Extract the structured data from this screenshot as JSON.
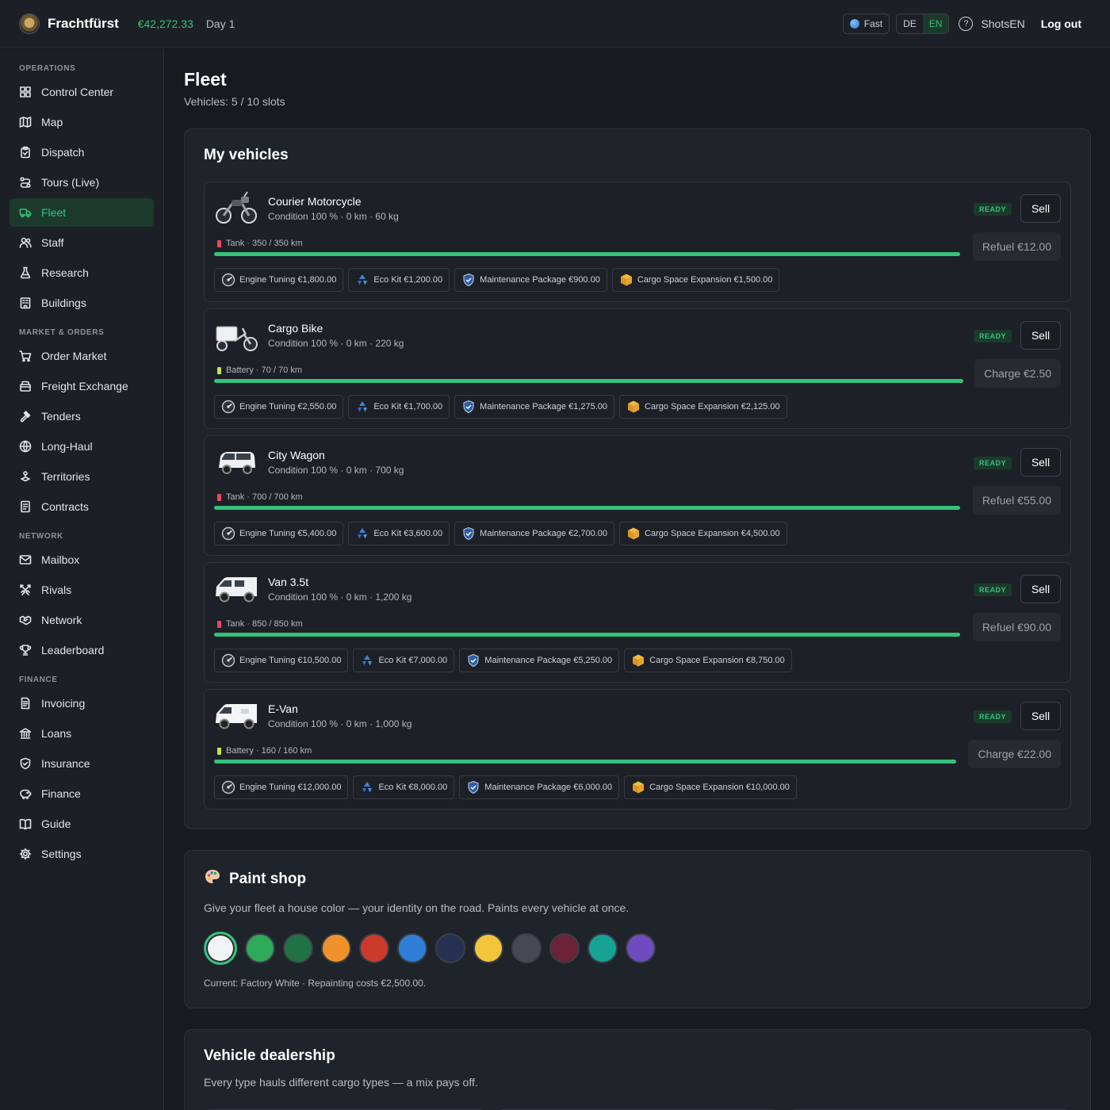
{
  "header": {
    "brand": "Frachtfürst",
    "balance": "€42,272.33",
    "day": "Day 1",
    "speed": "Fast",
    "languages": [
      "DE",
      "EN"
    ],
    "active_language": "EN",
    "user": "ShotsEN",
    "logout": "Log out"
  },
  "sidebar": {
    "sections": [
      {
        "title": "OPERATIONS",
        "items": [
          {
            "label": "Control Center",
            "icon": "grid-icon"
          },
          {
            "label": "Map",
            "icon": "map-icon"
          },
          {
            "label": "Dispatch",
            "icon": "clipboard-icon"
          },
          {
            "label": "Tours (Live)",
            "icon": "route-icon"
          },
          {
            "label": "Fleet",
            "icon": "truck-icon",
            "active": true
          },
          {
            "label": "Staff",
            "icon": "users-icon"
          },
          {
            "label": "Research",
            "icon": "flask-icon"
          },
          {
            "label": "Buildings",
            "icon": "building-icon"
          }
        ]
      },
      {
        "title": "MARKET & ORDERS",
        "items": [
          {
            "label": "Order Market",
            "icon": "cart-icon"
          },
          {
            "label": "Freight Exchange",
            "icon": "exchange-icon"
          },
          {
            "label": "Tenders",
            "icon": "gavel-icon"
          },
          {
            "label": "Long-Haul",
            "icon": "globe-icon"
          },
          {
            "label": "Territories",
            "icon": "territory-icon"
          },
          {
            "label": "Contracts",
            "icon": "contract-icon"
          }
        ]
      },
      {
        "title": "NETWORK",
        "items": [
          {
            "label": "Mailbox",
            "icon": "mail-icon"
          },
          {
            "label": "Rivals",
            "icon": "swords-icon"
          },
          {
            "label": "Network",
            "icon": "handshake-icon"
          },
          {
            "label": "Leaderboard",
            "icon": "trophy-icon"
          }
        ]
      },
      {
        "title": "FINANCE",
        "items": [
          {
            "label": "Invoicing",
            "icon": "invoice-icon"
          },
          {
            "label": "Loans",
            "icon": "bank-icon"
          },
          {
            "label": "Insurance",
            "icon": "shield-icon"
          },
          {
            "label": "Finance",
            "icon": "piggy-icon"
          },
          {
            "label": "Guide",
            "icon": "book-icon"
          },
          {
            "label": "Settings",
            "icon": "gear-icon"
          }
        ]
      }
    ]
  },
  "page": {
    "title": "Fleet",
    "subtitle": "Vehicles: 5 / 10 slots"
  },
  "vehicles_card": {
    "title": "My vehicles",
    "vehicles": [
      {
        "name": "Courier Motorcycle",
        "meta": "Condition 100 % · 0 km · 60 kg",
        "status": "READY",
        "sell": "Sell",
        "energy_label": "Tank · 350 / 350 km",
        "energy_type": "tank",
        "energy_level": 1.0,
        "refuel": "Refuel €12.00",
        "icon": "motorcycle-icon",
        "upgrades": [
          {
            "label": "Engine Tuning €1,800.00",
            "icon": "engine-icon"
          },
          {
            "label": "Eco Kit €1,200.00",
            "icon": "eco-icon"
          },
          {
            "label": "Maintenance Package €900.00",
            "icon": "shield-icon"
          },
          {
            "label": "Cargo Space Expansion €1,500.00",
            "icon": "cargo-icon"
          }
        ]
      },
      {
        "name": "Cargo Bike",
        "meta": "Condition 100 % · 0 km · 220 kg",
        "status": "READY",
        "sell": "Sell",
        "energy_label": "Battery · 70 / 70 km",
        "energy_type": "battery",
        "energy_level": 1.0,
        "refuel": "Charge €2.50",
        "icon": "cargo-bike-icon",
        "upgrades": [
          {
            "label": "Engine Tuning €2,550.00",
            "icon": "engine-icon"
          },
          {
            "label": "Eco Kit €1,700.00",
            "icon": "eco-icon"
          },
          {
            "label": "Maintenance Package €1,275.00",
            "icon": "shield-icon"
          },
          {
            "label": "Cargo Space Expansion €2,125.00",
            "icon": "cargo-icon"
          }
        ]
      },
      {
        "name": "City Wagon",
        "meta": "Condition 100 % · 0 km · 700 kg",
        "status": "READY",
        "sell": "Sell",
        "energy_label": "Tank · 700 / 700 km",
        "energy_type": "tank",
        "energy_level": 1.0,
        "refuel": "Refuel €55.00",
        "icon": "city-wagon-icon",
        "upgrades": [
          {
            "label": "Engine Tuning €5,400.00",
            "icon": "engine-icon"
          },
          {
            "label": "Eco Kit €3,600.00",
            "icon": "eco-icon"
          },
          {
            "label": "Maintenance Package €2,700.00",
            "icon": "shield-icon"
          },
          {
            "label": "Cargo Space Expansion €4,500.00",
            "icon": "cargo-icon"
          }
        ]
      },
      {
        "name": "Van 3.5t",
        "meta": "Condition 100 % · 0 km · 1,200 kg",
        "status": "READY",
        "sell": "Sell",
        "energy_label": "Tank · 850 / 850 km",
        "energy_type": "tank",
        "energy_level": 1.0,
        "refuel": "Refuel €90.00",
        "icon": "van-icon",
        "upgrades": [
          {
            "label": "Engine Tuning €10,500.00",
            "icon": "engine-icon"
          },
          {
            "label": "Eco Kit €7,000.00",
            "icon": "eco-icon"
          },
          {
            "label": "Maintenance Package €5,250.00",
            "icon": "shield-icon"
          },
          {
            "label": "Cargo Space Expansion €8,750.00",
            "icon": "cargo-icon"
          }
        ]
      },
      {
        "name": "E-Van",
        "meta": "Condition 100 % · 0 km · 1,000 kg",
        "status": "READY",
        "sell": "Sell",
        "energy_label": "Battery · 160 / 160 km",
        "energy_type": "battery",
        "energy_level": 1.0,
        "refuel": "Charge €22.00",
        "icon": "e-van-icon",
        "upgrades": [
          {
            "label": "Engine Tuning €12,000.00",
            "icon": "engine-icon"
          },
          {
            "label": "Eco Kit €8,000.00",
            "icon": "eco-icon"
          },
          {
            "label": "Maintenance Package €6,000.00",
            "icon": "shield-icon"
          },
          {
            "label": "Cargo Space Expansion €10,000.00",
            "icon": "cargo-icon"
          }
        ]
      }
    ]
  },
  "paint_shop": {
    "title": "Paint shop",
    "description": "Give your fleet a house color — your identity on the road. Paints every vehicle at once.",
    "colors": [
      "#f2f3f5",
      "#2ea85a",
      "#217346",
      "#f0922b",
      "#cc3a2b",
      "#2f7fd8",
      "#263152",
      "#f2c53d",
      "#464a52",
      "#6e2235",
      "#16a394",
      "#6f4bbf"
    ],
    "selected_index": 0,
    "note": "Current: Factory White · Repainting costs €2,500.00."
  },
  "dealership": {
    "title": "Vehicle dealership",
    "description": "Every type hauls different cargo types — a mix pays off."
  },
  "colors": {
    "accent": "#34c27a",
    "tank": "#e84a5f",
    "battery": "#c4e04a"
  }
}
